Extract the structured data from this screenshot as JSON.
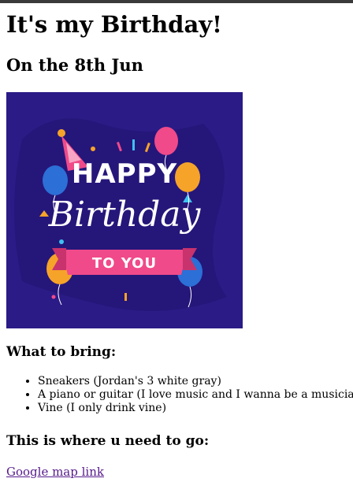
{
  "page": {
    "title": "It's my Birthday!",
    "date": "On the 8th Jun"
  },
  "banner": {
    "word1": "HAPPY",
    "word2": "Birthday",
    "word3": "TO YOU",
    "background_color": "#2a1b86",
    "accent_pink": "#f04a8a",
    "accent_blue": "#2c6fd6",
    "accent_orange": "#f6a329"
  },
  "bring": {
    "heading": "What to bring:",
    "items": [
      "Sneakers (Jordan's 3 white gray)",
      "A piano or guitar (I love music and I wanna be a musician)",
      "Vine (I only drink vine)"
    ]
  },
  "location": {
    "heading": "This is where u need to go:",
    "link_label": "Google map link",
    "link_color": "#551a8b"
  }
}
